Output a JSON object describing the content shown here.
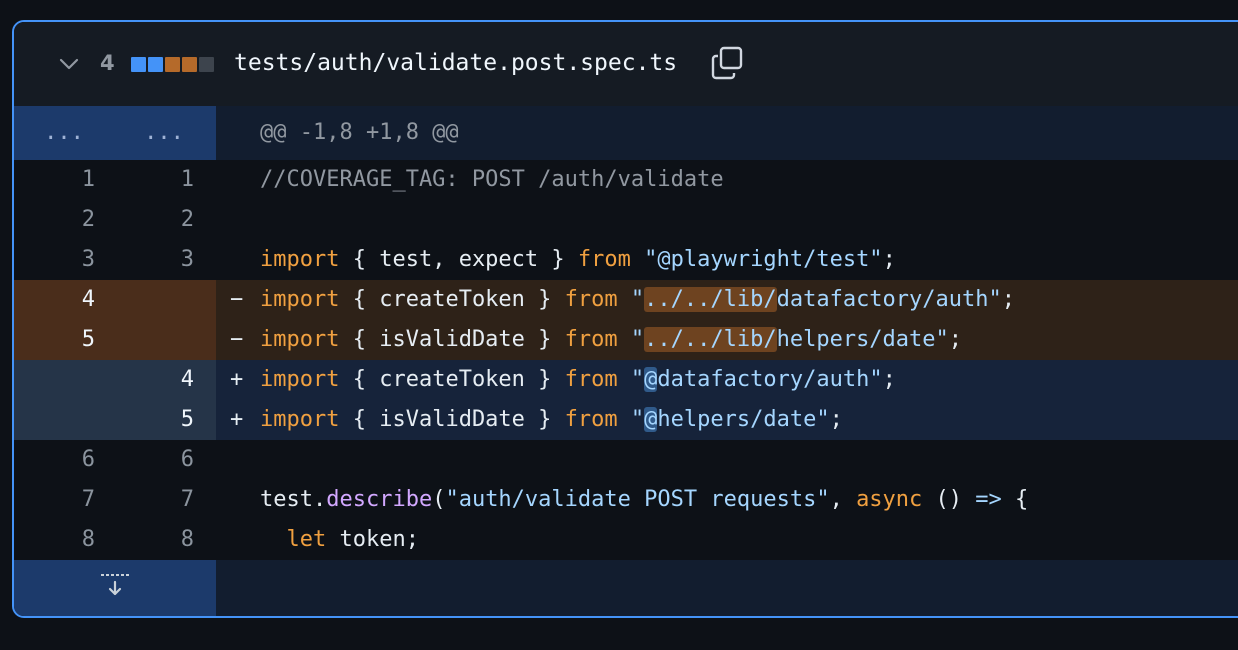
{
  "file": {
    "change_count": "4",
    "path": "tests/auth/validate.post.spec.ts",
    "blocks": [
      "#4493f8",
      "#4493f8",
      "#b56a2a",
      "#b56a2a",
      "#3d444d"
    ]
  },
  "hunk": {
    "old_marker": "...",
    "new_marker": "...",
    "header": "@@ -1,8 +1,8 @@"
  },
  "lines": [
    {
      "old": "1",
      "new": "1",
      "type": "ctx",
      "parts": [
        [
          "cm",
          "//COVERAGE_TAG: POST /auth/validate"
        ]
      ]
    },
    {
      "old": "2",
      "new": "2",
      "type": "ctx",
      "parts": []
    },
    {
      "old": "3",
      "new": "3",
      "type": "ctx",
      "parts": [
        [
          "kw",
          "import"
        ],
        [
          "",
          "{ test, expect } "
        ],
        [
          "kw",
          "from"
        ],
        [
          "",
          " "
        ],
        [
          "str",
          "\"@playwright/test\""
        ],
        [
          "",
          ";"
        ]
      ]
    },
    {
      "old": "4",
      "new": "",
      "type": "del",
      "parts": [
        [
          "kw",
          "import"
        ],
        [
          "",
          "{ createToken } "
        ],
        [
          "kw",
          "from"
        ],
        [
          "",
          " "
        ],
        [
          "str",
          "\""
        ],
        [
          "str hl-del",
          "../../lib/"
        ],
        [
          "str",
          "datafactory/auth\""
        ],
        [
          "",
          ";"
        ]
      ]
    },
    {
      "old": "5",
      "new": "",
      "type": "del",
      "parts": [
        [
          "kw",
          "import"
        ],
        [
          "",
          "{ isValidDate } "
        ],
        [
          "kw",
          "from"
        ],
        [
          "",
          " "
        ],
        [
          "str",
          "\""
        ],
        [
          "str hl-del",
          "../../lib/"
        ],
        [
          "str",
          "helpers/date\""
        ],
        [
          "",
          ";"
        ]
      ]
    },
    {
      "old": "",
      "new": "4",
      "type": "add",
      "parts": [
        [
          "kw",
          "import"
        ],
        [
          "",
          "{ createToken } "
        ],
        [
          "kw",
          "from"
        ],
        [
          "",
          " "
        ],
        [
          "str",
          "\""
        ],
        [
          "str hl-add",
          "@"
        ],
        [
          "str",
          "datafactory/auth\""
        ],
        [
          "",
          ";"
        ]
      ]
    },
    {
      "old": "",
      "new": "5",
      "type": "add",
      "parts": [
        [
          "kw",
          "import"
        ],
        [
          "",
          "{ isValidDate } "
        ],
        [
          "kw",
          "from"
        ],
        [
          "",
          " "
        ],
        [
          "str",
          "\""
        ],
        [
          "str hl-add",
          "@"
        ],
        [
          "str",
          "helpers/date\""
        ],
        [
          "",
          ";"
        ]
      ]
    },
    {
      "old": "6",
      "new": "6",
      "type": "ctx",
      "parts": []
    },
    {
      "old": "7",
      "new": "7",
      "type": "ctx",
      "parts": [
        [
          "",
          "test."
        ],
        [
          "fn",
          "describe"
        ],
        [
          "",
          "("
        ],
        [
          "str",
          "\"auth/validate POST requests\""
        ],
        [
          "",
          ", "
        ],
        [
          "kw",
          "async"
        ],
        [
          "",
          " () "
        ],
        [
          "str",
          "=>"
        ],
        [
          "",
          " {"
        ]
      ]
    },
    {
      "old": "8",
      "new": "8",
      "type": "ctx",
      "parts": [
        [
          "",
          "  "
        ],
        [
          "kw",
          "let"
        ],
        [
          "",
          " token;"
        ]
      ]
    }
  ],
  "markers": {
    "del": "−",
    "add": "+"
  },
  "icons": {
    "collapse": "chevron-down-icon",
    "copy": "copy-icon",
    "expand": "expand-down-icon"
  }
}
